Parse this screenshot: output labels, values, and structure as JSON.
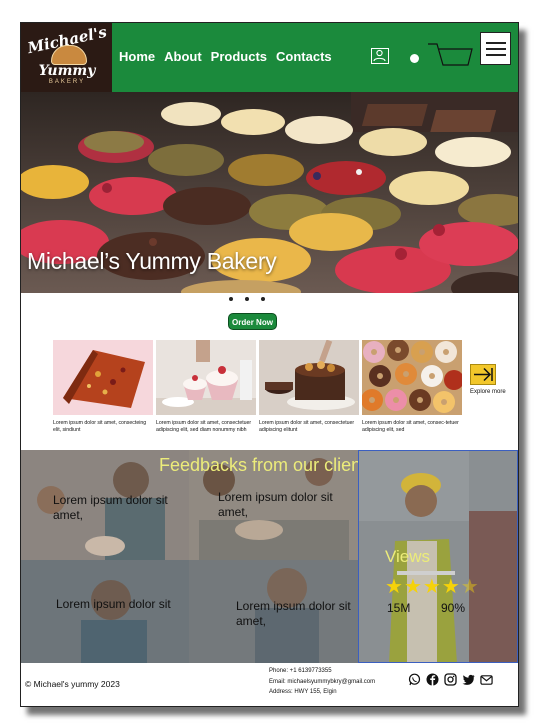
{
  "brand": {
    "line1": "Michael's",
    "line2": "Yummy",
    "line3": "BAKERY"
  },
  "nav": {
    "items": [
      {
        "label": "Home"
      },
      {
        "label": "About"
      },
      {
        "label": "Products"
      },
      {
        "label": "Contacts"
      }
    ],
    "icons": [
      "user-icon",
      "dot-icon",
      "cart-icon",
      "hamburger-menu-icon"
    ]
  },
  "hero": {
    "title": "Michael’s Yummy Bakery",
    "carousel_dots": 3,
    "cta_label": "Order Now"
  },
  "products": [
    {
      "caption": "Lorem ipsum dolor sit amet, consecteing elit, sindiunt",
      "image": "fruit-loaf-cake"
    },
    {
      "caption": "Lorem ipsum dolor sit amet, consectetuer adipiscing elit, sed diam nonummy nibh",
      "image": "cupcakes"
    },
    {
      "caption": "Lorem ipsum dolor sit amet, consectetuer adipiscing elitunt",
      "image": "chocolate-cake"
    },
    {
      "caption": "Lorem ipsum dolor sit amet, consec-tetuer adipiscing elit, sed",
      "image": "donuts"
    }
  ],
  "explore": {
    "label": "Explore more",
    "icon": "arrow-right-icon"
  },
  "feedback": {
    "title": "Feedbacks from our clients",
    "items": [
      {
        "text": "Lorem ipsum dolor sit amet,"
      },
      {
        "text": "Lorem ipsum dolor sit amet,"
      },
      {
        "text": "Lorem ipsum dolor sit"
      },
      {
        "text": "Lorem ipsum dolor sit amet,"
      }
    ]
  },
  "views": {
    "title": "Views",
    "rating": 4,
    "rating_max": 5,
    "count": "15M",
    "percent": "90%"
  },
  "footer": {
    "copyright": "© Michael's yummy 2023",
    "phone": "Phone: +1 6139773355",
    "email": "Email: michaelsyummybkry@gmail.com",
    "address": "Address: HWY 155, Elgin",
    "social": [
      "whatsapp-icon",
      "facebook-icon",
      "instagram-icon",
      "twitter-icon",
      "mail-icon"
    ]
  },
  "colors": {
    "brand_green": "#1b8a3c",
    "logo_bg": "#2b1a14",
    "accent_yellow": "#f2c72b",
    "feedback_text": "#ecec7a",
    "star": "#f5d20a"
  }
}
